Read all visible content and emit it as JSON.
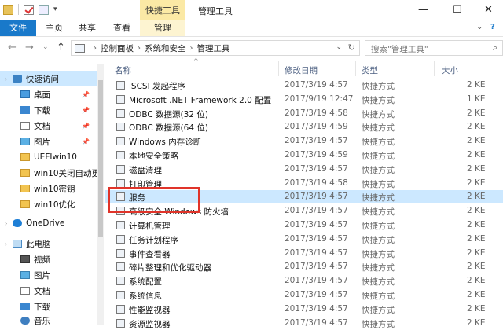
{
  "window": {
    "title": "管理工具",
    "context_tab_group": "快捷工具",
    "controls": {
      "minimize": "—",
      "maximize": "☐",
      "close": "✕"
    }
  },
  "quick_access_toolbar": {
    "dropdown": "▾"
  },
  "ribbon": {
    "tabs": [
      {
        "label": "文件"
      },
      {
        "label": "主页"
      },
      {
        "label": "共享"
      },
      {
        "label": "查看"
      },
      {
        "label": "管理"
      }
    ],
    "expand_glyph": "⌄",
    "help_glyph": "?"
  },
  "address_bar": {
    "back": "←",
    "forward": "→",
    "recent": "⌄",
    "up": "↑",
    "separator": "›",
    "breadcrumb": [
      "控制面板",
      "系统和安全",
      "管理工具"
    ],
    "dropdown": "⌄",
    "refresh": "↻"
  },
  "search": {
    "placeholder": "搜索\"管理工具\"",
    "icon": "⌕"
  },
  "nav_pane": {
    "expander": "›",
    "pin_glyph": "📌",
    "items": [
      {
        "label": "快速访问",
        "icon": "star-icon"
      },
      {
        "label": "桌面",
        "icon": "desktop-icon",
        "pinned": true
      },
      {
        "label": "下载",
        "icon": "download-icon",
        "pinned": true
      },
      {
        "label": "文档",
        "icon": "document-icon",
        "pinned": true
      },
      {
        "label": "图片",
        "icon": "pictures-icon",
        "pinned": true
      },
      {
        "label": "UEFIwin10",
        "icon": "folder-icon"
      },
      {
        "label": "win10关闭自动更",
        "icon": "folder-icon"
      },
      {
        "label": "win10密钥",
        "icon": "folder-icon"
      },
      {
        "label": "win10优化",
        "icon": "folder-icon"
      },
      {
        "label": "OneDrive",
        "icon": "onedrive-icon"
      },
      {
        "label": "此电脑",
        "icon": "this-pc-icon"
      },
      {
        "label": "视频",
        "icon": "videos-icon"
      },
      {
        "label": "图片",
        "icon": "pictures-icon"
      },
      {
        "label": "文档",
        "icon": "document-icon"
      },
      {
        "label": "下载",
        "icon": "download-icon"
      },
      {
        "label": "音乐",
        "icon": "music-icon"
      }
    ]
  },
  "file_list": {
    "columns": {
      "name": "名称",
      "date": "修改日期",
      "type": "类型",
      "size": "大小"
    },
    "sort_indicator": "^",
    "rows": [
      {
        "name": "iSCSI 发起程序",
        "date": "2017/3/19 4:57",
        "type": "快捷方式",
        "size": "2 KE"
      },
      {
        "name": "Microsoft .NET Framework 2.0 配置",
        "date": "2017/9/19 12:47",
        "type": "快捷方式",
        "size": "1 KE"
      },
      {
        "name": "ODBC 数据源(32 位)",
        "date": "2017/3/19 4:58",
        "type": "快捷方式",
        "size": "2 KE"
      },
      {
        "name": "ODBC 数据源(64 位)",
        "date": "2017/3/19 4:59",
        "type": "快捷方式",
        "size": "2 KE"
      },
      {
        "name": "Windows 内存诊断",
        "date": "2017/3/19 4:57",
        "type": "快捷方式",
        "size": "2 KE"
      },
      {
        "name": "本地安全策略",
        "date": "2017/3/19 4:59",
        "type": "快捷方式",
        "size": "2 KE"
      },
      {
        "name": "磁盘清理",
        "date": "2017/3/19 4:57",
        "type": "快捷方式",
        "size": "2 KE"
      },
      {
        "name": "打印管理",
        "date": "2017/3/19 4:58",
        "type": "快捷方式",
        "size": "2 KE"
      },
      {
        "name": "服务",
        "date": "2017/3/19 4:57",
        "type": "快捷方式",
        "size": "2 KE",
        "selected": true
      },
      {
        "name": "高级安全 Windows 防火墙",
        "date": "2017/3/19 4:57",
        "type": "快捷方式",
        "size": "2 KE"
      },
      {
        "name": "计算机管理",
        "date": "2017/3/19 4:57",
        "type": "快捷方式",
        "size": "2 KE"
      },
      {
        "name": "任务计划程序",
        "date": "2017/3/19 4:57",
        "type": "快捷方式",
        "size": "2 KE"
      },
      {
        "name": "事件查看器",
        "date": "2017/3/19 4:57",
        "type": "快捷方式",
        "size": "2 KE"
      },
      {
        "name": "碎片整理和优化驱动器",
        "date": "2017/3/19 4:57",
        "type": "快捷方式",
        "size": "2 KE"
      },
      {
        "name": "系统配置",
        "date": "2017/3/19 4:57",
        "type": "快捷方式",
        "size": "2 KE"
      },
      {
        "name": "系统信息",
        "date": "2017/3/19 4:57",
        "type": "快捷方式",
        "size": "2 KE"
      },
      {
        "name": "性能监视器",
        "date": "2017/3/19 4:57",
        "type": "快捷方式",
        "size": "2 KE"
      },
      {
        "name": "资源监视器",
        "date": "2017/3/19 4:57",
        "type": "快捷方式",
        "size": "2 KE"
      }
    ]
  }
}
